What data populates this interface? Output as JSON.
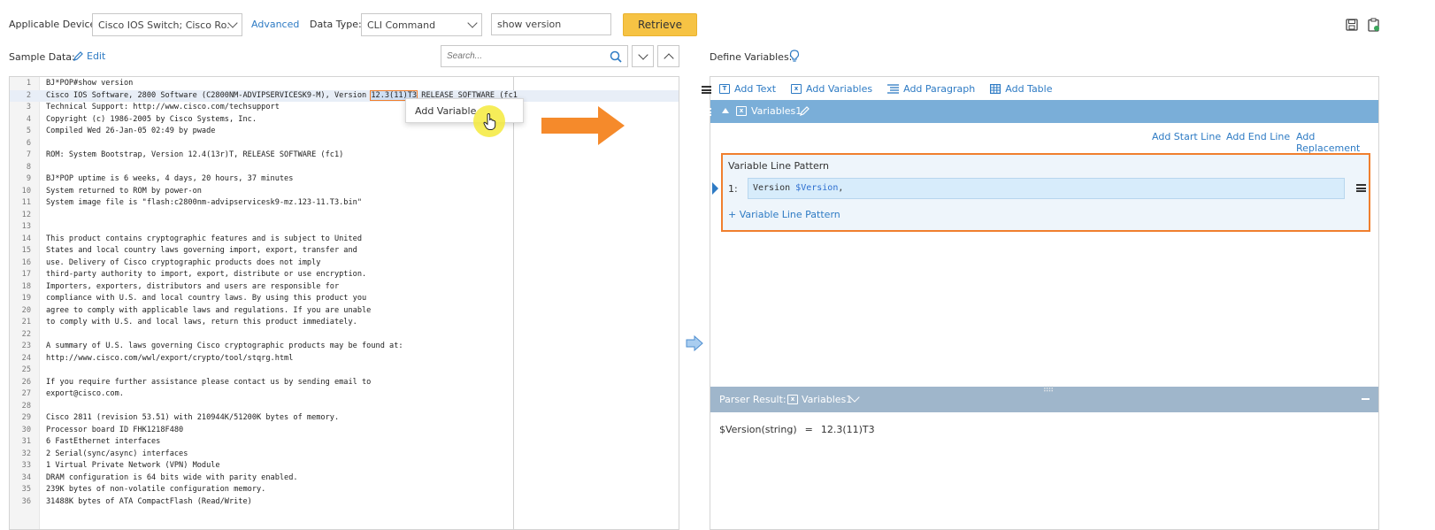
{
  "top": {
    "applicable_device_label": "Applicable Device:",
    "device_value": "Cisco IOS Switch; Cisco Ro...",
    "advanced_link": "Advanced",
    "data_type_label": "Data Type:",
    "data_type_value": "CLI Command",
    "command_value": "show version",
    "retrieve_label": "Retrieve"
  },
  "sample": {
    "label": "Sample Data:",
    "edit_label": "Edit",
    "search_placeholder": "Search..."
  },
  "editor": {
    "lines": [
      {
        "n": "1",
        "t": "BJ*POP#show version"
      },
      {
        "n": "2",
        "t": "Cisco IOS Software, 2800 Software (C2800NM-ADVIPSERVICESK9-M), Version ",
        "sel": "12.3(11)T3",
        "after": " RELEASE SOFTWARE (fc1"
      },
      {
        "n": "3",
        "t": "Technical Support: http://www.cisco.com/techsupport"
      },
      {
        "n": "4",
        "t": "Copyright (c) 1986-2005 by Cisco Systems, Inc."
      },
      {
        "n": "5",
        "t": "Compiled Wed 26-Jan-05 02:49 by pwade"
      },
      {
        "n": "6",
        "t": ""
      },
      {
        "n": "7",
        "t": "ROM: System Bootstrap, Version 12.4(13r)T, RELEASE SOFTWARE (fc1)"
      },
      {
        "n": "8",
        "t": ""
      },
      {
        "n": "9",
        "t": "BJ*POP uptime is 6 weeks, 4 days, 20 hours, 37 minutes"
      },
      {
        "n": "10",
        "t": "System returned to ROM by power-on"
      },
      {
        "n": "11",
        "t": "System image file is \"flash:c2800nm-advipservicesk9-mz.123-11.T3.bin\""
      },
      {
        "n": "12",
        "t": ""
      },
      {
        "n": "13",
        "t": ""
      },
      {
        "n": "14",
        "t": "This product contains cryptographic features and is subject to United"
      },
      {
        "n": "15",
        "t": "States and local country laws governing import, export, transfer and"
      },
      {
        "n": "16",
        "t": "use. Delivery of Cisco cryptographic products does not imply"
      },
      {
        "n": "17",
        "t": "third-party authority to import, export, distribute or use encryption."
      },
      {
        "n": "18",
        "t": "Importers, exporters, distributors and users are responsible for"
      },
      {
        "n": "19",
        "t": "compliance with U.S. and local country laws. By using this product you"
      },
      {
        "n": "20",
        "t": "agree to comply with applicable laws and regulations. If you are unable"
      },
      {
        "n": "21",
        "t": "to comply with U.S. and local laws, return this product immediately."
      },
      {
        "n": "22",
        "t": ""
      },
      {
        "n": "23",
        "t": "A summary of U.S. laws governing Cisco cryptographic products may be found at:"
      },
      {
        "n": "24",
        "t": "http://www.cisco.com/wwl/export/crypto/tool/stqrg.html"
      },
      {
        "n": "25",
        "t": ""
      },
      {
        "n": "26",
        "t": "If you require further assistance please contact us by sending email to"
      },
      {
        "n": "27",
        "t": "export@cisco.com."
      },
      {
        "n": "28",
        "t": ""
      },
      {
        "n": "29",
        "t": "Cisco 2811 (revision 53.51) with 210944K/51200K bytes of memory."
      },
      {
        "n": "30",
        "t": "Processor board ID FHK1218F480"
      },
      {
        "n": "31",
        "t": "6 FastEthernet interfaces"
      },
      {
        "n": "32",
        "t": "2 Serial(sync/async) interfaces"
      },
      {
        "n": "33",
        "t": "1 Virtual Private Network (VPN) Module"
      },
      {
        "n": "34",
        "t": "DRAM configuration is 64 bits wide with parity enabled."
      },
      {
        "n": "35",
        "t": "239K bytes of non-volatile configuration memory."
      },
      {
        "n": "36",
        "t": "31488K bytes of ATA CompactFlash (Read/Write)"
      }
    ]
  },
  "context_menu": {
    "add_variable": "Add Variable"
  },
  "define": {
    "label": "Define Variables:",
    "toolbar": {
      "add_text": "Add Text",
      "add_variables": "Add Variables",
      "add_paragraph": "Add Paragraph",
      "add_table": "Add Table"
    },
    "section_title": "Variables1",
    "actions": {
      "add_start_line": "Add Start Line",
      "add_end_line": "Add End Line",
      "add_replacement": "Add Replacement"
    },
    "pattern_title": "Variable Line Pattern",
    "pattern_index": "1:",
    "pattern_text": "Version ",
    "pattern_var": "$Version",
    "pattern_tail": ",",
    "add_pattern_link": "+ Variable Line Pattern"
  },
  "result": {
    "label": "Parser Result:",
    "variable": "Variables1",
    "var_name": "$Version(string)",
    "equals": "=",
    "value": "12.3(11)T3"
  },
  "colors": {
    "accent": "#2e7bc4",
    "retrieve": "#f6c344",
    "highlight": "#f07f2e",
    "section_bar": "#7aaed8"
  }
}
